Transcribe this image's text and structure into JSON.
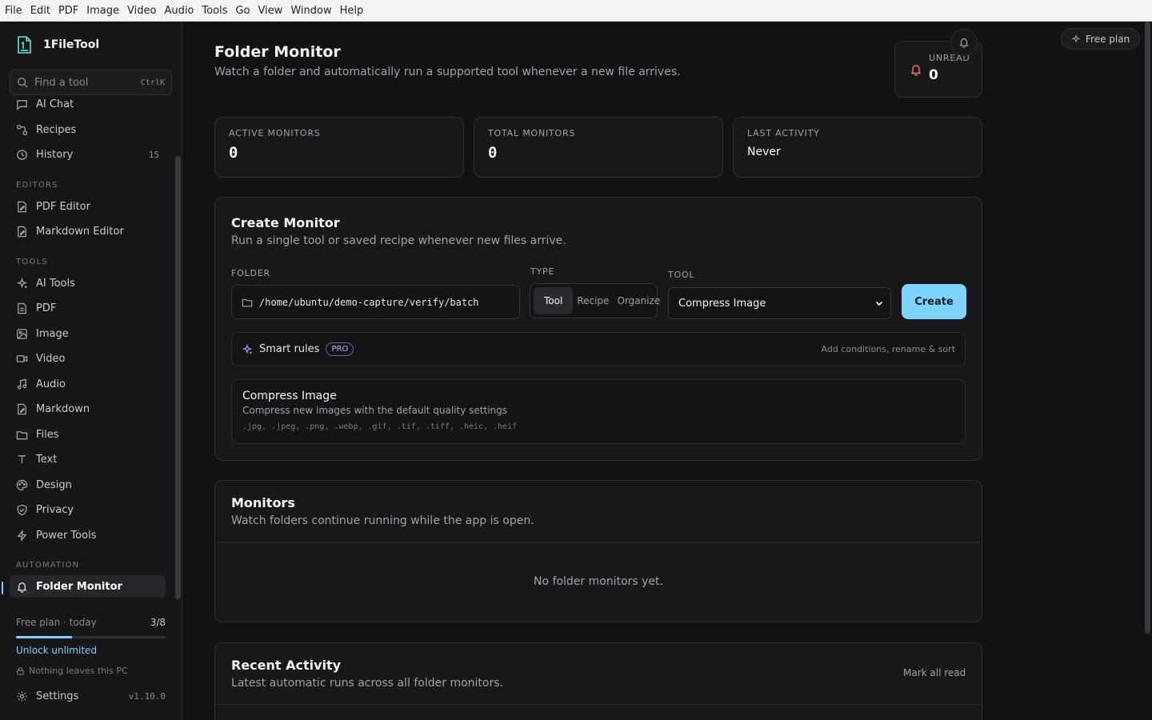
{
  "menubar": [
    "File",
    "Edit",
    "PDF",
    "Image",
    "Video",
    "Audio",
    "Tools",
    "Go",
    "View",
    "Window",
    "Help"
  ],
  "app": {
    "name": "1FileTool"
  },
  "search": {
    "placeholder": "Find a tool",
    "shortcut": "CtrlK"
  },
  "nav": {
    "top": [
      {
        "label": "AI Chat",
        "icon": "chat-icon"
      },
      {
        "label": "Recipes",
        "icon": "recipes-icon"
      },
      {
        "label": "History",
        "icon": "history-icon",
        "count": "15"
      }
    ],
    "editors_header": "EDITORS",
    "editors": [
      {
        "label": "PDF Editor",
        "icon": "pdf-editor-icon"
      },
      {
        "label": "Markdown Editor",
        "icon": "markdown-editor-icon"
      }
    ],
    "tools_header": "TOOLS",
    "tools": [
      {
        "label": "AI Tools",
        "icon": "sparkles-icon"
      },
      {
        "label": "PDF",
        "icon": "file-icon"
      },
      {
        "label": "Image",
        "icon": "image-icon"
      },
      {
        "label": "Video",
        "icon": "video-icon"
      },
      {
        "label": "Audio",
        "icon": "music-icon"
      },
      {
        "label": "Markdown",
        "icon": "markdown-icon"
      },
      {
        "label": "Files",
        "icon": "folder-icon"
      },
      {
        "label": "Text",
        "icon": "text-icon"
      },
      {
        "label": "Design",
        "icon": "palette-icon"
      },
      {
        "label": "Privacy",
        "icon": "shield-icon"
      },
      {
        "label": "Power Tools",
        "icon": "bolt-icon"
      }
    ],
    "automation_header": "AUTOMATION",
    "automation": [
      {
        "label": "Folder Monitor",
        "icon": "bell-icon",
        "active": true
      }
    ]
  },
  "sidebar_footer": {
    "plan_label": "Free plan · today",
    "plan_usage": "3/8",
    "usage_fraction": 0.375,
    "unlock": "Unlock unlimited",
    "privacy_note": "Nothing leaves this PC",
    "settings": "Settings",
    "version": "v1.10.0"
  },
  "header": {
    "title": "Folder Monitor",
    "subtitle": "Watch a folder and automatically run a supported tool whenever a new file arrives.",
    "unread_label": "UNREAD",
    "unread_value": "0",
    "free_plan": "Free plan"
  },
  "stats": [
    {
      "label": "ACTIVE MONITORS",
      "value": "0"
    },
    {
      "label": "TOTAL MONITORS",
      "value": "0"
    },
    {
      "label": "LAST ACTIVITY",
      "value": "Never"
    }
  ],
  "create": {
    "title": "Create Monitor",
    "subtitle": "Run a single tool or saved recipe whenever new files arrive.",
    "folder_label": "FOLDER",
    "folder_value": "/home/ubuntu/demo-capture/verify/batch",
    "type_label": "TYPE",
    "type_options": [
      "Tool",
      "Recipe",
      "Organize"
    ],
    "type_selected": "Tool",
    "tool_label": "TOOL",
    "tool_value": "Compress Image",
    "create_button": "Create",
    "smart_rules": "Smart rules",
    "smart_badge": "PRO",
    "smart_hint": "Add conditions, rename & sort",
    "tool_info_title": "Compress Image",
    "tool_info_desc": "Compress new images with the default quality settings",
    "tool_info_ext": ".jpg, .jpeg, .png, .webp, .gif, .tif, .tiff, .heic, .heif"
  },
  "monitors": {
    "title": "Monitors",
    "subtitle": "Watch folders continue running while the app is open.",
    "empty": "No folder monitors yet."
  },
  "activity": {
    "title": "Recent Activity",
    "subtitle": "Latest automatic runs across all folder monitors.",
    "mark_all_read": "Mark all read"
  },
  "colors": {
    "accent": "#7dd3fc",
    "background": "#121214",
    "card": "#18181b",
    "pro": "#c4b5fd"
  }
}
